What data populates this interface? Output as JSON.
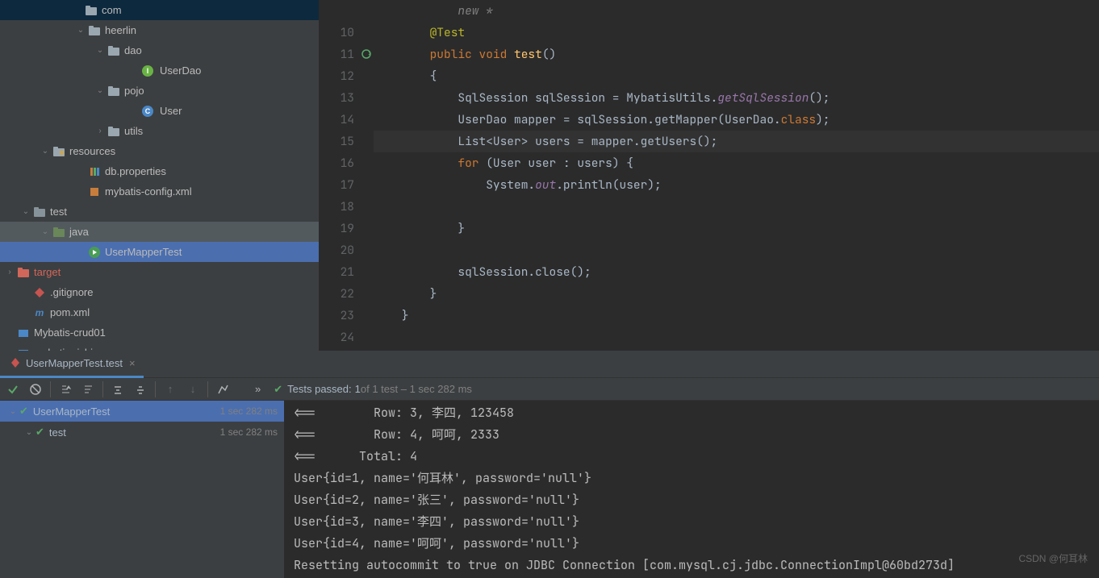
{
  "sidebar": {
    "items": [
      {
        "indent": 88,
        "chev": "",
        "icon": "pkg",
        "label": "com"
      },
      {
        "indent": 92,
        "chev": "v",
        "icon": "pkg",
        "label": "heerlin"
      },
      {
        "indent": 116,
        "chev": "v",
        "icon": "pkg",
        "label": "dao"
      },
      {
        "indent": 160,
        "chev": "",
        "icon": "int",
        "label": "UserDao"
      },
      {
        "indent": 116,
        "chev": "v",
        "icon": "pkg",
        "label": "pojo"
      },
      {
        "indent": 160,
        "chev": "",
        "icon": "cls",
        "label": "User"
      },
      {
        "indent": 116,
        "chev": ">",
        "icon": "pkg",
        "label": "utils"
      },
      {
        "indent": 48,
        "chev": "v",
        "icon": "res",
        "label": "resources"
      },
      {
        "indent": 92,
        "chev": "",
        "icon": "prop",
        "label": "db.properties"
      },
      {
        "indent": 92,
        "chev": "",
        "icon": "xml",
        "label": "mybatis-config.xml"
      },
      {
        "indent": 24,
        "chev": "v",
        "icon": "fld",
        "label": "test"
      },
      {
        "indent": 48,
        "chev": "v",
        "icon": "fldg",
        "label": "java",
        "sel2": true
      },
      {
        "indent": 92,
        "chev": "",
        "icon": "run",
        "label": "UserMapperTest",
        "sel": true
      },
      {
        "indent": 4,
        "chev": ">",
        "icon": "fldo",
        "label": "target",
        "orange": true
      },
      {
        "indent": 24,
        "chev": "",
        "icon": "git",
        "label": ".gitignore"
      },
      {
        "indent": 24,
        "chev": "",
        "icon": "mvn",
        "label": "pom.xml"
      },
      {
        "indent": 4,
        "chev": "",
        "icon": "mod",
        "label": "Mybatis-crud01"
      },
      {
        "indent": 4,
        "chev": "",
        "icon": "mod",
        "label": "mybatis-rizhi"
      }
    ]
  },
  "editor": {
    "lines": [
      {
        "num": "",
        "segs": [
          [
            "",
            "            new *"
          ]
        ],
        "comment": true
      },
      {
        "num": "10",
        "segs": [
          [
            "anno",
            "        @Test"
          ]
        ]
      },
      {
        "num": "11",
        "segs": [
          [
            "",
            "        "
          ],
          [
            "kw",
            "public void"
          ],
          [
            "",
            " "
          ],
          [
            "method",
            "test"
          ],
          [
            "",
            "()"
          ]
        ],
        "gi": "rerun"
      },
      {
        "num": "12",
        "segs": [
          [
            "",
            "        {"
          ]
        ]
      },
      {
        "num": "13",
        "segs": [
          [
            "",
            "            SqlSession sqlSession = MybatisUtils."
          ],
          [
            "static",
            "getSqlSession"
          ],
          [
            "",
            "();"
          ]
        ]
      },
      {
        "num": "14",
        "segs": [
          [
            "",
            "            UserDao mapper = sqlSession.getMapper(UserDao."
          ],
          [
            "kw",
            "class"
          ],
          [
            "",
            ");"
          ]
        ]
      },
      {
        "num": "15",
        "segs": [
          [
            "",
            "            List<User> users = mapper.getUsers();"
          ]
        ],
        "hl": true
      },
      {
        "num": "16",
        "segs": [
          [
            "",
            "            "
          ],
          [
            "kw",
            "for"
          ],
          [
            "",
            " (User user : users) {"
          ]
        ]
      },
      {
        "num": "17",
        "segs": [
          [
            "",
            "                System."
          ],
          [
            "static",
            "out"
          ],
          [
            "",
            ".println(user);"
          ]
        ]
      },
      {
        "num": "18",
        "segs": [
          [
            "",
            ""
          ]
        ]
      },
      {
        "num": "19",
        "segs": [
          [
            "",
            "            }"
          ]
        ]
      },
      {
        "num": "20",
        "segs": [
          [
            "",
            ""
          ]
        ]
      },
      {
        "num": "21",
        "segs": [
          [
            "",
            "            sqlSession.close();"
          ]
        ]
      },
      {
        "num": "22",
        "segs": [
          [
            "",
            "        }"
          ]
        ]
      },
      {
        "num": "23",
        "segs": [
          [
            "",
            "    }"
          ]
        ]
      },
      {
        "num": "24",
        "segs": [
          [
            "",
            ""
          ]
        ]
      }
    ]
  },
  "run_tab": {
    "label": "UserMapperTest.test",
    "close": "×"
  },
  "test_status": {
    "passed_label": "Tests passed:",
    "passed_count": "1",
    "of_text": " of 1 test – 1 sec 282 ms"
  },
  "test_tree": [
    {
      "indent": 0,
      "name": "UserMapperTest",
      "time": "1 sec 282 ms",
      "sel": true
    },
    {
      "indent": 20,
      "name": "test",
      "time": "1 sec 282 ms"
    }
  ],
  "console": [
    "<==        Row: 3, 李四, 123458",
    "<==        Row: 4, 呵呵, 2333",
    "<==      Total: 4",
    "User{id=1, name='何耳林', password='null'}",
    "User{id=2, name='张三', password='null'}",
    "User{id=3, name='李四', password='null'}",
    "User{id=4, name='呵呵', password='null'}",
    "Resetting autocommit to true on JDBC Connection [com.mysql.cj.jdbc.ConnectionImpl@60bd273d]"
  ],
  "watermark": "CSDN @何耳林"
}
